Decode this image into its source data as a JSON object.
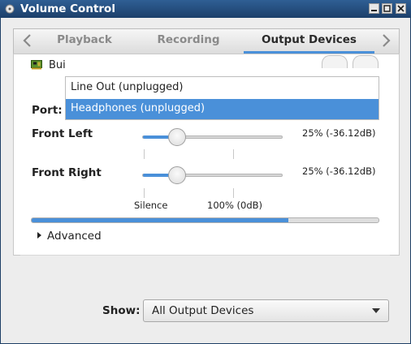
{
  "window": {
    "title": "Volume Control"
  },
  "tabs": [
    {
      "label": "Playback"
    },
    {
      "label": "Recording"
    },
    {
      "label": "Output Devices"
    }
  ],
  "device": {
    "name_visible": "Bui",
    "port_label": "Port:",
    "port_options": [
      "Line Out (unplugged)",
      "Headphones (unplugged)"
    ],
    "port_selected": "Headphones (unplugged)"
  },
  "channels": [
    {
      "label": "Front Left",
      "value_text": "25% (-36.12dB)",
      "level": 0.25
    },
    {
      "label": "Front Right",
      "value_text": "25% (-36.12dB)",
      "level": 0.25
    }
  ],
  "scale_marks": {
    "silence": "Silence",
    "full": "100% (0dB)"
  },
  "peak_meter": {
    "level": 0.74
  },
  "advanced": {
    "label": "Advanced"
  },
  "show": {
    "label": "Show:",
    "selected": "All Output Devices"
  }
}
